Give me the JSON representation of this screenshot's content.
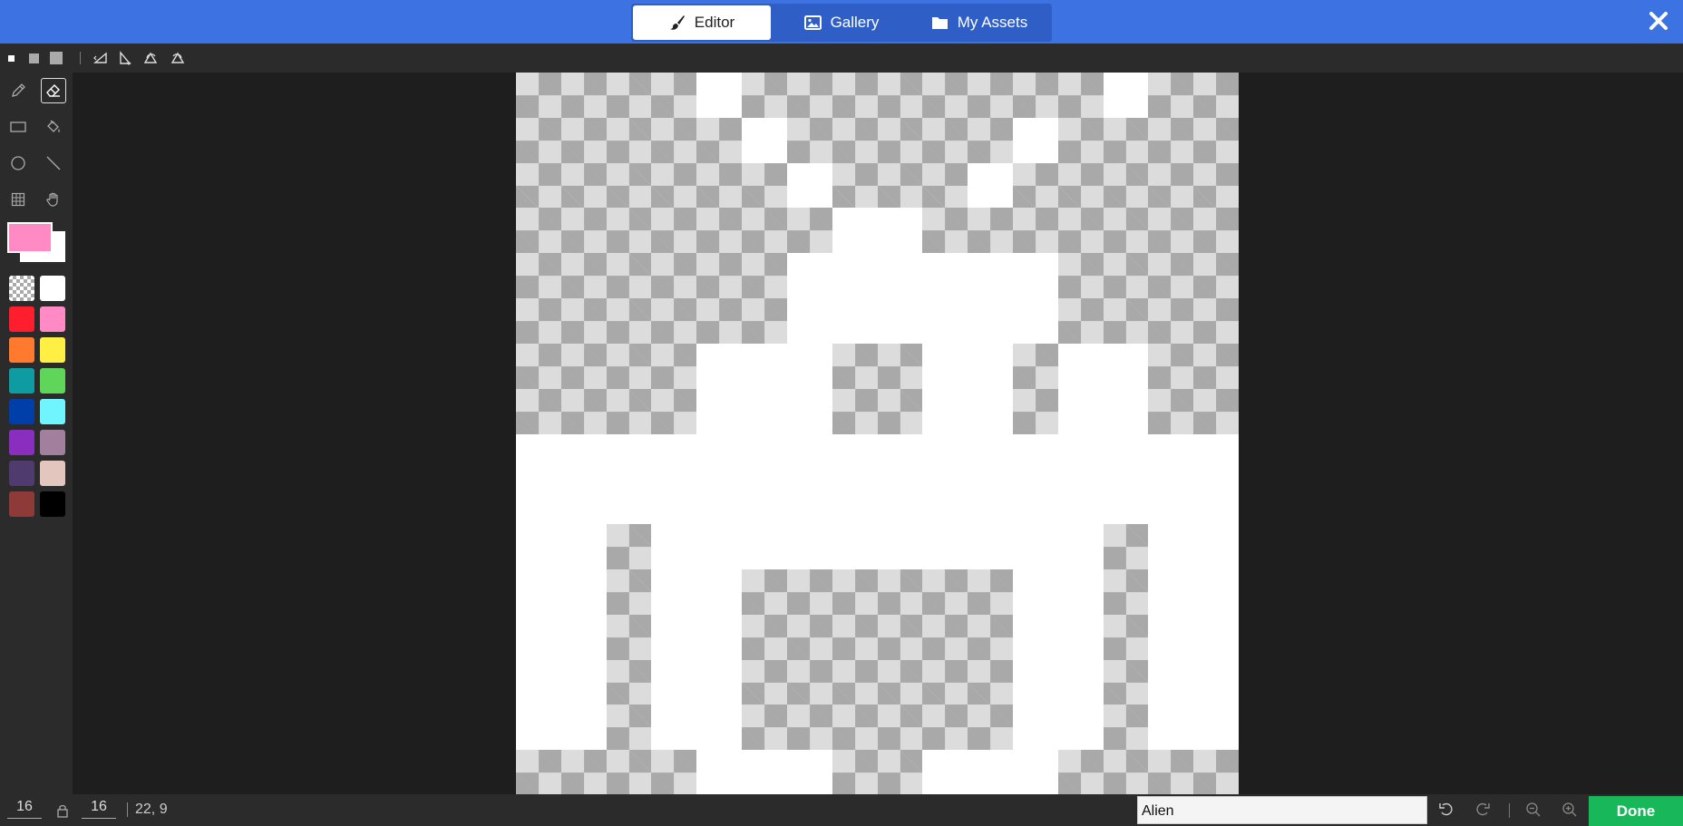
{
  "tabs": [
    {
      "label": "Editor",
      "icon": "paintbrush-icon",
      "active": true
    },
    {
      "label": "Gallery",
      "icon": "image-icon",
      "active": false
    },
    {
      "label": "My Assets",
      "icon": "folder-icon",
      "active": false
    }
  ],
  "toolbar": {
    "brush_sizes": [
      "small-brush",
      "medium-brush",
      "large-brush"
    ],
    "transforms": [
      "flip-horizontal-icon",
      "flip-vertical-icon",
      "rotate-clockwise-icon",
      "rotate-counterclockwise-icon"
    ]
  },
  "tools": [
    "pencil-icon",
    "eraser-icon",
    "rectangle-icon",
    "fill-bucket-icon",
    "circle-icon",
    "line-icon",
    "marquee-icon",
    "pan-hand-icon"
  ],
  "selected_tool": "eraser-icon",
  "colors": {
    "primary": "#ff8ac4",
    "secondary": "#ffffff",
    "palette": [
      "transparent",
      "#ffffff",
      "#ff1e2d",
      "#ff8ac4",
      "#ff7a2f",
      "#ffef45",
      "#0e9ba2",
      "#5fd55a",
      "#003fa9",
      "#70f5ff",
      "#8a2ec0",
      "#a37f9e",
      "#4f3b6e",
      "#e3c7bf",
      "#8e3a39",
      "#000000"
    ]
  },
  "canvas": {
    "width": 16,
    "height": 16,
    "pixels": [
      "TTTTWTTTTTTTTWTT",
      "TTTTTWTTTTTWTTTT",
      "TTTTTTWTTTWTTTTT",
      "TTTTTTTWWTTTTTTT",
      "TTTTTTWWWWWWTTTT",
      "TTTTTTWWWWWWTTTT",
      "TTTTWWWTTWWTWWTT",
      "TTTTWWWTTWWTWWTT",
      "WWWWWWWWWWWWWWWW",
      "WWWWWWWWWWWWWWWW",
      "WWTWWWWWWWWWWTWW",
      "WWTWWTTTTTTWWTWW",
      "WWTWWTTTTTTWWTWW",
      "WWTWWTTTTTTWWTWW",
      "WWTWWTTTTTTWWTWW",
      "TTTTWWWTTWWWTTTT"
    ]
  },
  "bottom": {
    "width_value": "16",
    "height_value": "16",
    "coords": "22, 9",
    "asset_name": "Alien",
    "done_label": "Done"
  }
}
